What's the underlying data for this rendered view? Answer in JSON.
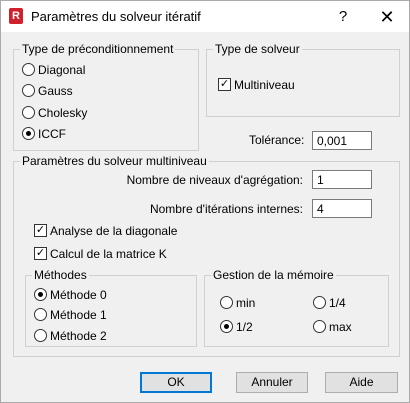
{
  "window": {
    "title": "Paramètres du solveur itératif",
    "app_icon_letter": "R",
    "help_label": "?",
    "close_label": "✕",
    "accent": "#d11f2b"
  },
  "preconditioning": {
    "legend": "Type de préconditionnement",
    "options": [
      {
        "label": "Diagonal",
        "selected": false
      },
      {
        "label": "Gauss",
        "selected": false
      },
      {
        "label": "Cholesky",
        "selected": false
      },
      {
        "label": "ICCF",
        "selected": true
      }
    ]
  },
  "solver_type": {
    "legend": "Type de solveur",
    "multilevel_label": "Multiniveau",
    "multilevel_checked": true
  },
  "tolerance": {
    "label": "Tolérance:",
    "value": "0,001"
  },
  "multilevel": {
    "legend": "Paramètres du solveur multiniveau",
    "aggregation_label": "Nombre de niveaux d'agrégation:",
    "aggregation_value": "1",
    "iterations_label": "Nombre d'itérations internes:",
    "iterations_value": "4",
    "diag_analysis_label": "Analyse de la diagonale",
    "diag_analysis_checked": true,
    "matrix_calc_label": "Calcul de la matrice K",
    "matrix_calc_checked": true
  },
  "methods": {
    "legend": "Méthodes",
    "options": [
      {
        "label": "Méthode 0",
        "selected": true
      },
      {
        "label": "Méthode 1",
        "selected": false
      },
      {
        "label": "Méthode 2",
        "selected": false
      }
    ]
  },
  "memory": {
    "legend": "Gestion de la mémoire",
    "options": [
      {
        "label": "min",
        "selected": false
      },
      {
        "label": "1/4",
        "selected": false
      },
      {
        "label": "1/2",
        "selected": true
      },
      {
        "label": "max",
        "selected": false
      }
    ]
  },
  "buttons": {
    "ok": "OK",
    "cancel": "Annuler",
    "help": "Aide"
  }
}
